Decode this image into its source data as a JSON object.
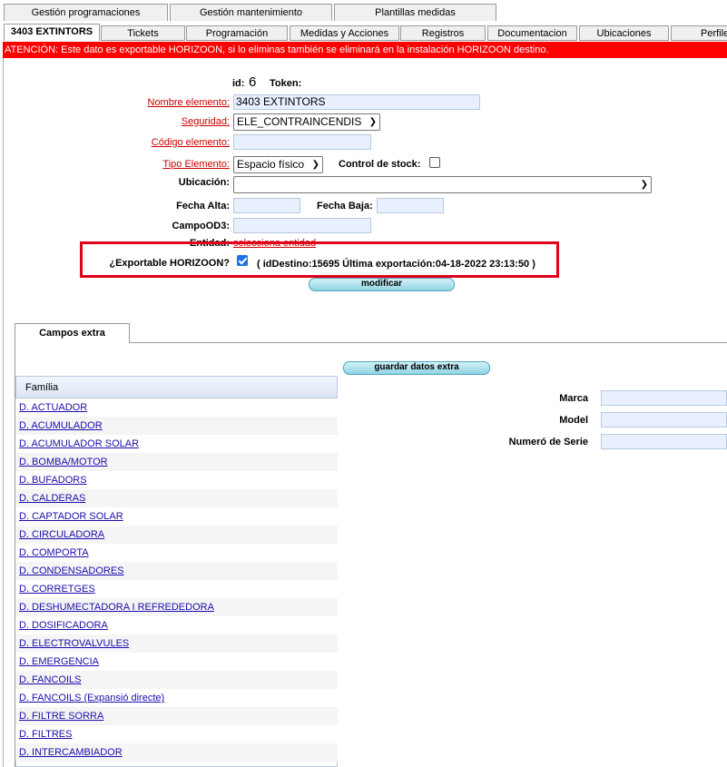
{
  "top_tabs": [
    "Gestión programaciones",
    "Gestión mantenimiento",
    "Plantillas medidas"
  ],
  "sub_tabs": [
    "3403 EXTINTORS",
    "Tickets",
    "Programación",
    "Medidas y Acciones",
    "Registros",
    "Documentacion",
    "Ubicaciones",
    "Perfile"
  ],
  "warning": "ATENCIÓN: Este dato es exportable HORIZOON, si lo eliminas también se eliminará en la instalación HORIZOON destino.",
  "form": {
    "id_label": "id:",
    "id_value": "6",
    "token_label": "Token:",
    "nombre_label": "Nombre elemento:",
    "nombre_value": "3403 EXTINTORS",
    "seguridad_label": "Seguridad:",
    "seguridad_value": "ELE_CONTRAINCENDIS",
    "codigo_label": "Código elemento:",
    "codigo_value": "",
    "tipo_label": "Tipo Elemento:",
    "tipo_value": "Espacio físico",
    "stock_label": "Control de stock:",
    "ubicacion_label": "Ubicación:",
    "ubicacion_value": "",
    "fecha_alta_label": "Fecha Alta:",
    "fecha_baja_label": "Fecha Baja:",
    "campo_label": "CampoOD3:",
    "entidad_label": "Entidad:",
    "entidad_link": "selecciona entidad",
    "export_label": "¿Exportable HORIZOON?",
    "export_checked": true,
    "export_info": "( idDestino:15695 Última exportación:04-18-2022 23:13:50 )",
    "modificar_label": "modificar"
  },
  "extra": {
    "tab_label": "Campos extra",
    "guardar_label": "guardar datos extra",
    "familia_header": "Família",
    "familias": [
      "D. ACTUADOR",
      "D. ACUMULADOR",
      "D. ACUMULADOR SOLAR",
      "D. BOMBA/MOTOR",
      "D. BUFADORS",
      "D. CALDERAS",
      "D. CAPTADOR SOLAR",
      "D. CIRCULADORA",
      "D. COMPORTA",
      "D. CONDENSADORES",
      "D. CORRETGES",
      "D. DESHUMECTADORA I REFREDEDORA",
      "D. DOSIFICADORA",
      "D. ELECTROVALVULES",
      "D. EMERGENCIA",
      "D. FANCOILS",
      "D. FANCOILS (Expansió directe)",
      "D. FILTRE SORRA",
      "D. FILTRES",
      "D. INTERCAMBIADOR"
    ],
    "fields": [
      "Marca",
      "Model",
      "Numeró de Serie"
    ]
  },
  "colors": {
    "warning_bg": "#ff0000",
    "highlight_border": "#e0001a",
    "input_bg": "#e8f0fe",
    "link": "#1a0dab"
  }
}
